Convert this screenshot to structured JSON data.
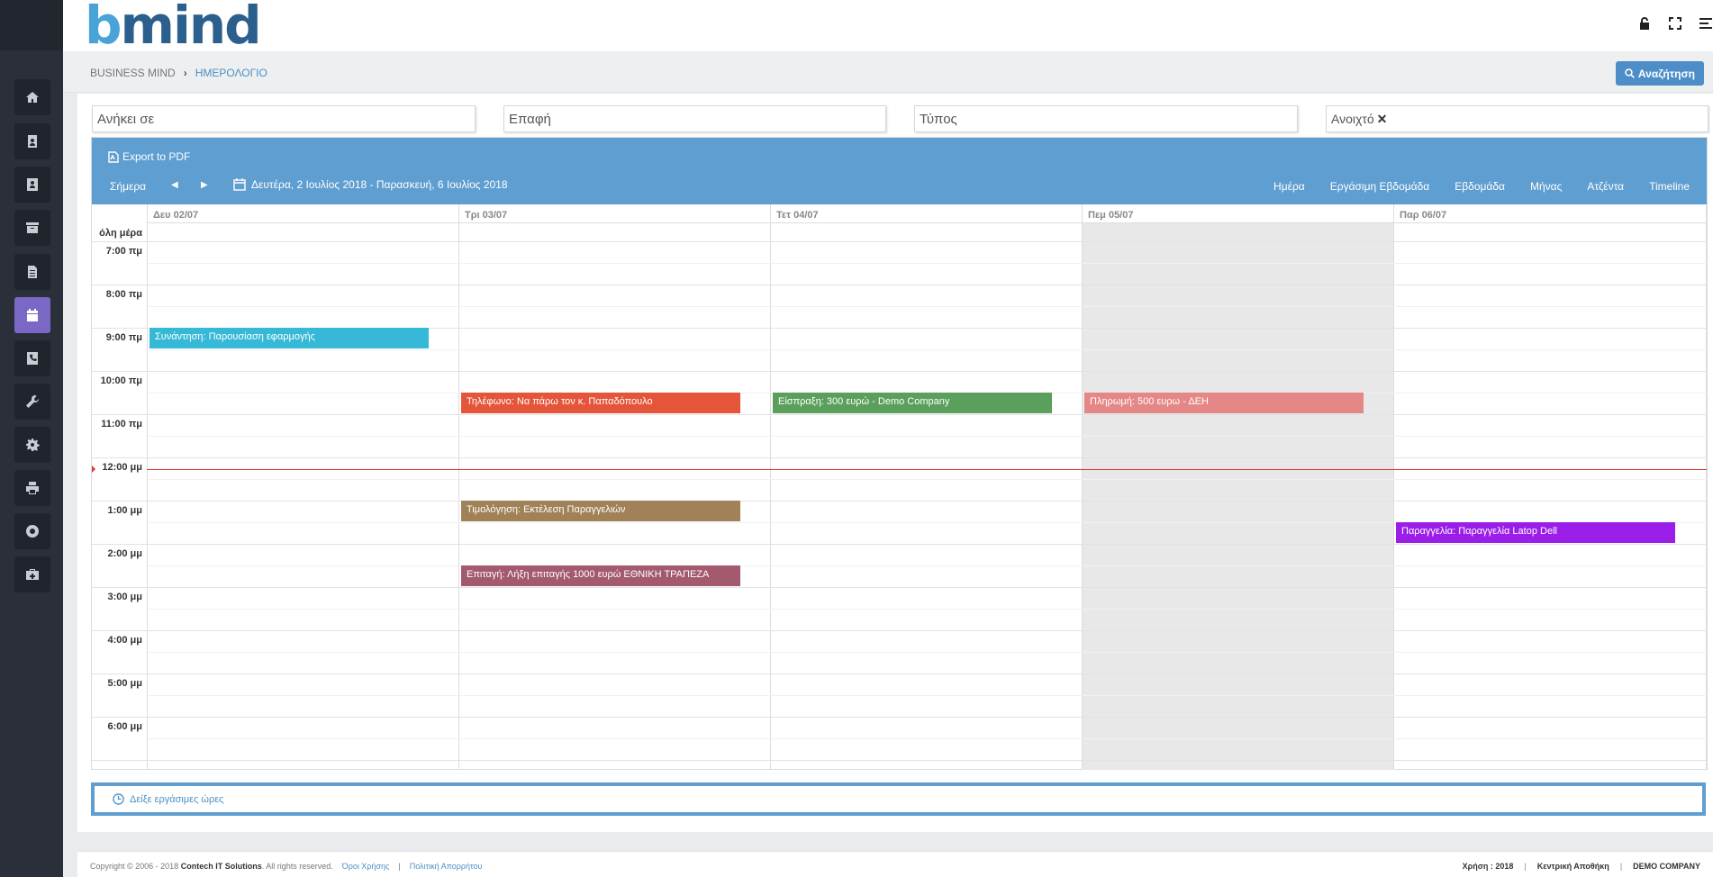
{
  "app": {
    "logo_b": "b",
    "logo_rest": "mind"
  },
  "sidebar": {
    "items": [
      {
        "name": "home",
        "icon": "home-icon"
      },
      {
        "name": "contacts",
        "icon": "contact-card-icon"
      },
      {
        "name": "customers",
        "icon": "person-card-icon"
      },
      {
        "name": "archive",
        "icon": "archive-box-icon"
      },
      {
        "name": "documents",
        "icon": "document-icon"
      },
      {
        "name": "calendar",
        "icon": "calendar-icon",
        "active": true
      },
      {
        "name": "calls",
        "icon": "phone-icon"
      },
      {
        "name": "tools",
        "icon": "wrench-icon"
      },
      {
        "name": "settings",
        "icon": "gear-icon"
      },
      {
        "name": "print",
        "icon": "printer-icon"
      },
      {
        "name": "support",
        "icon": "lifebuoy-icon"
      },
      {
        "name": "toolbox",
        "icon": "toolbox-icon"
      }
    ]
  },
  "breadcrumb": {
    "root": "BUSINESS MIND",
    "separator": "›",
    "current": "ΗΜΕΡΟΛΟΓΙΟ"
  },
  "search_button": "Αναζήτηση",
  "filters": {
    "belongs_to": "Ανήκει σε",
    "contact": "Επαφή",
    "type": "Τύπος",
    "status": "Ανοιχτό",
    "status_clear": "✕"
  },
  "calendar": {
    "export": "Export to PDF",
    "today": "Σήμερα",
    "prev": "◀",
    "next": "▶",
    "range": "Δευτέρα, 2 Ιουλίος 2018 - Παρασκευή, 6 Ιουλίος 2018",
    "views": [
      "Ημέρα",
      "Εργάσιμη Εβδομάδα",
      "Εβδομάδα",
      "Μήνας",
      "Ατζέντα",
      "Timeline"
    ],
    "days": [
      "Δευ 02/07",
      "Τρι 03/07",
      "Τετ 04/07",
      "Πεμ 05/07",
      "Παρ 06/07"
    ],
    "today_index": 3,
    "all_day_label": "όλη μέρα",
    "hours": [
      "7:00 πμ",
      "8:00 πμ",
      "9:00 πμ",
      "10:00 πμ",
      "11:00 πμ",
      "12:00 μμ",
      "1:00 μμ",
      "2:00 μμ",
      "3:00 μμ",
      "4:00 μμ",
      "5:00 μμ",
      "6:00 μμ"
    ],
    "events": [
      {
        "day": 0,
        "start": "9:00",
        "title": "Συνάντηση: Παρουσίαση εφαρμογής",
        "color": "#36b9d6"
      },
      {
        "day": 1,
        "start": "10:30",
        "title": "Τηλέφωνο: Να πάρω τον κ. Παπαδόπουλο",
        "color": "#e4553a"
      },
      {
        "day": 2,
        "start": "10:30",
        "title": "Είσπραξη: 300 ευρώ - Demo Company",
        "color": "#5aa05c"
      },
      {
        "day": 3,
        "start": "10:30",
        "title": "Πληρωμή: 500 ευρω - ΔΕΗ",
        "color": "#e58787"
      },
      {
        "day": 1,
        "start": "13:00",
        "title": "Τιμολόγηση: Εκτέλεση Παραγγελιών",
        "color": "#a08158"
      },
      {
        "day": 4,
        "start": "13:30",
        "title": "Παραγγελία: Παραγγελία Latop Dell",
        "color": "#9b1ee8"
      },
      {
        "day": 1,
        "start": "14:30",
        "title": "Επιταγή: Λήξη επιταγής 1000 ευρώ ΕΘΝΙΚΗ ΤΡΑΠΕΖΑ",
        "color": "#a35a6e"
      }
    ]
  },
  "show_work_hours": "Δείξε εργάσιμες ώρες",
  "footer": {
    "copyright": "Copyright © 2006 - 2018",
    "company": "Contech IT Solutions",
    "rights": ". All rights reserved.",
    "terms": "Όροι Χρήσης",
    "privacy": "Πολιτική Απορρήτου",
    "divider": "|",
    "year": "Χρήση : 2018",
    "warehouse": "Κεντρική Αποθήκη",
    "company_name": "DEMO COMPANY"
  }
}
